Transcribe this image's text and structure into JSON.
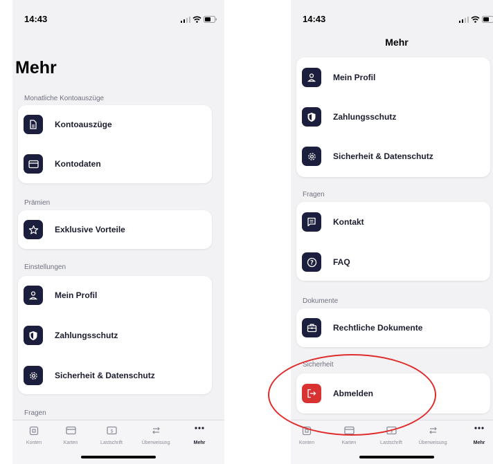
{
  "status": {
    "time": "14:43"
  },
  "left_screen": {
    "title": "Mehr",
    "sections": [
      {
        "label": "Monatliche Kontoauszüge",
        "items": [
          {
            "label": "Kontoauszüge",
            "icon": "document-icon"
          },
          {
            "label": "Kontodaten",
            "icon": "card-icon"
          }
        ]
      },
      {
        "label": "Prämien",
        "items": [
          {
            "label": "Exklusive Vorteile",
            "icon": "star-icon"
          }
        ]
      },
      {
        "label": "Einstellungen",
        "items": [
          {
            "label": "Mein Profil",
            "icon": "profile-icon"
          },
          {
            "label": "Zahlungsschutz",
            "icon": "shield-icon"
          },
          {
            "label": "Sicherheit & Datenschutz",
            "icon": "gear-icon"
          }
        ]
      },
      {
        "label": "Fragen",
        "items": []
      }
    ]
  },
  "right_screen": {
    "title": "Mehr",
    "sections": [
      {
        "label": "",
        "items": [
          {
            "label": "Mein Profil",
            "icon": "profile-icon"
          },
          {
            "label": "Zahlungsschutz",
            "icon": "shield-icon"
          },
          {
            "label": "Sicherheit & Datenschutz",
            "icon": "gear-icon"
          }
        ]
      },
      {
        "label": "Fragen",
        "items": [
          {
            "label": "Kontakt",
            "icon": "message-icon"
          },
          {
            "label": "FAQ",
            "icon": "question-icon"
          }
        ]
      },
      {
        "label": "Dokumente",
        "items": [
          {
            "label": "Rechtliche Dokumente",
            "icon": "briefcase-icon"
          }
        ]
      },
      {
        "label": "Sicherheit",
        "items": [
          {
            "label": "Abmelden",
            "icon": "logout-icon"
          }
        ]
      }
    ]
  },
  "tabbar": [
    {
      "label": "Konten",
      "icon": "account-icon"
    },
    {
      "label": "Karten",
      "icon": "card-icon"
    },
    {
      "label": "Lastschrift",
      "icon": "debit-icon"
    },
    {
      "label": "Überweisung",
      "icon": "transfer-icon"
    },
    {
      "label": "Mehr",
      "icon": "more-icon",
      "active": true
    }
  ],
  "colors": {
    "icon_bg": "#1b1e3d",
    "logout_bg": "#d93232",
    "highlight": "#e12b2b",
    "screen_bg": "#f2f2f4"
  }
}
